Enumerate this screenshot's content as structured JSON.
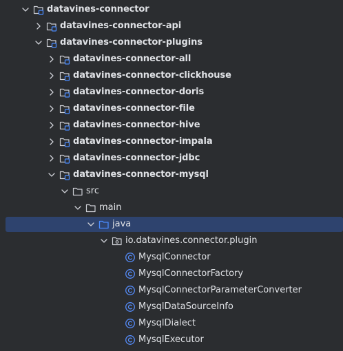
{
  "colors": {
    "background": "#2b2d30",
    "selection": "#2e436e",
    "text": "#dfe1e5",
    "icon_stroke": "#ced0d6",
    "module_badge": "#4a8cff",
    "class_icon": "#548af7"
  },
  "tree": [
    {
      "label": "datavines-connector",
      "icon": "module-folder-icon",
      "chevron": "expanded",
      "depth": 0
    },
    {
      "label": "datavines-connector-api",
      "icon": "module-folder-icon",
      "chevron": "collapsed",
      "depth": 1
    },
    {
      "label": "datavines-connector-plugins",
      "icon": "module-folder-icon",
      "chevron": "expanded",
      "depth": 1
    },
    {
      "label": "datavines-connector-all",
      "icon": "module-folder-icon",
      "chevron": "collapsed",
      "depth": 2
    },
    {
      "label": "datavines-connector-clickhouse",
      "icon": "module-folder-icon",
      "chevron": "collapsed",
      "depth": 2
    },
    {
      "label": "datavines-connector-doris",
      "icon": "module-folder-icon",
      "chevron": "collapsed",
      "depth": 2
    },
    {
      "label": "datavines-connector-file",
      "icon": "module-folder-icon",
      "chevron": "collapsed",
      "depth": 2
    },
    {
      "label": "datavines-connector-hive",
      "icon": "module-folder-icon",
      "chevron": "collapsed",
      "depth": 2
    },
    {
      "label": "datavines-connector-impala",
      "icon": "module-folder-icon",
      "chevron": "collapsed",
      "depth": 2
    },
    {
      "label": "datavines-connector-jdbc",
      "icon": "module-folder-icon",
      "chevron": "collapsed",
      "depth": 2
    },
    {
      "label": "datavines-connector-mysql",
      "icon": "module-folder-icon",
      "chevron": "expanded",
      "depth": 2
    },
    {
      "label": "src",
      "icon": "folder-icon",
      "chevron": "expanded",
      "depth": 3
    },
    {
      "label": "main",
      "icon": "folder-icon",
      "chevron": "expanded",
      "depth": 4
    },
    {
      "label": "java",
      "icon": "source-root-icon",
      "chevron": "expanded",
      "depth": 5,
      "selected": true
    },
    {
      "label": "io.datavines.connector.plugin",
      "icon": "package-icon",
      "chevron": "expanded",
      "depth": 6
    },
    {
      "label": "MysqlConnector",
      "icon": "class-icon",
      "chevron": "none",
      "depth": 7
    },
    {
      "label": "MysqlConnectorFactory",
      "icon": "class-icon",
      "chevron": "none",
      "depth": 7
    },
    {
      "label": "MysqlConnectorParameterConverter",
      "icon": "class-icon",
      "chevron": "none",
      "depth": 7
    },
    {
      "label": "MysqlDataSourceInfo",
      "icon": "class-icon",
      "chevron": "none",
      "depth": 7
    },
    {
      "label": "MysqlDialect",
      "icon": "class-icon",
      "chevron": "none",
      "depth": 7
    },
    {
      "label": "MysqlExecutor",
      "icon": "class-icon",
      "chevron": "none",
      "depth": 7
    }
  ]
}
